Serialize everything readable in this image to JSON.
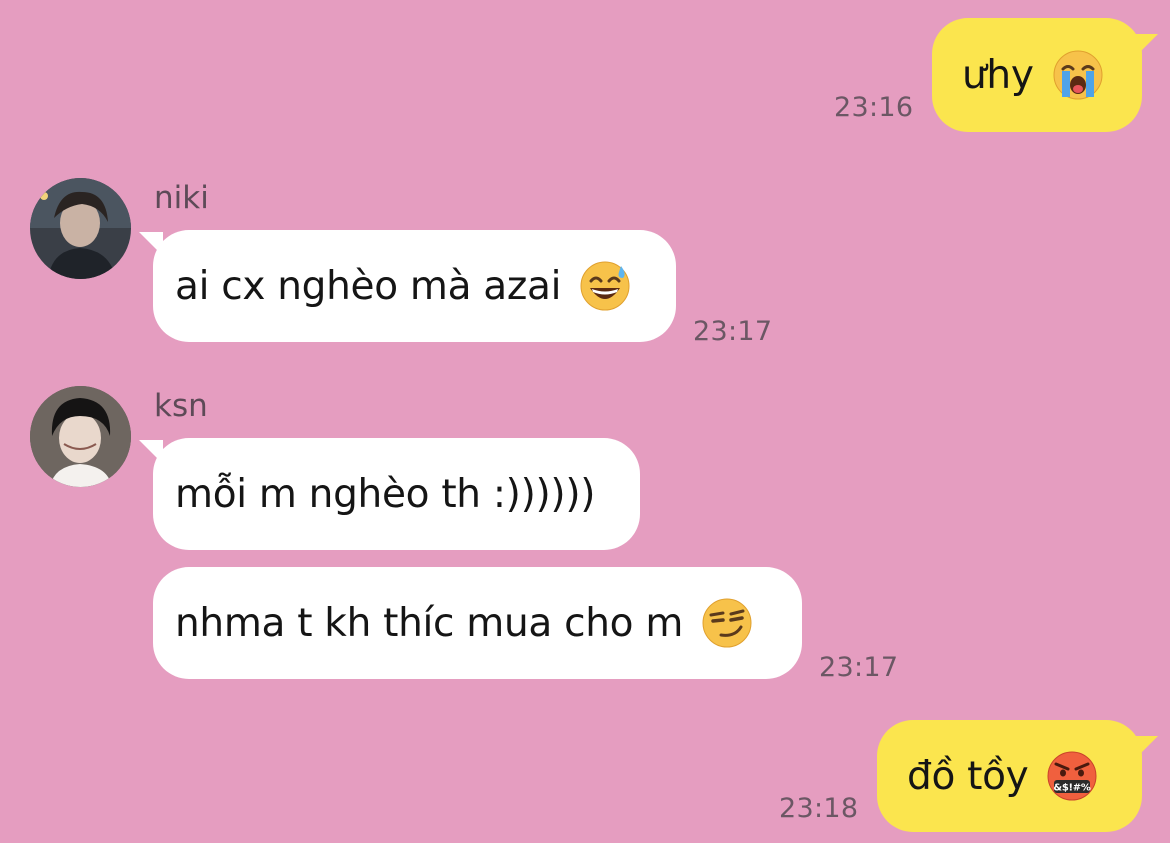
{
  "messages": [
    {
      "sender": "me",
      "text": "ưhy",
      "emoji": "loudly-crying-face",
      "time": "23:16"
    },
    {
      "sender": "niki",
      "text": "ai cx nghèo mà azai",
      "emoji": "grinning-face-with-sweat",
      "time": "23:17"
    },
    {
      "sender": "ksn",
      "text": "mỗi m nghèo th :))))))",
      "emoji": ""
    },
    {
      "sender": "ksn",
      "text": "nhma t kh thíc mua cho m",
      "emoji": "smirking-face",
      "time": "23:17"
    },
    {
      "sender": "me",
      "text": "đồ tồy",
      "emoji": "face-with-symbols-on-mouth",
      "time": "23:18"
    }
  ],
  "contacts": {
    "niki": {
      "name": "niki"
    },
    "ksn": {
      "name": "ksn"
    }
  },
  "colors": {
    "background": "#e59dc0",
    "my_bubble": "#fbe54e",
    "their_bubble": "#ffffff",
    "timestamp": "#6b5764"
  }
}
